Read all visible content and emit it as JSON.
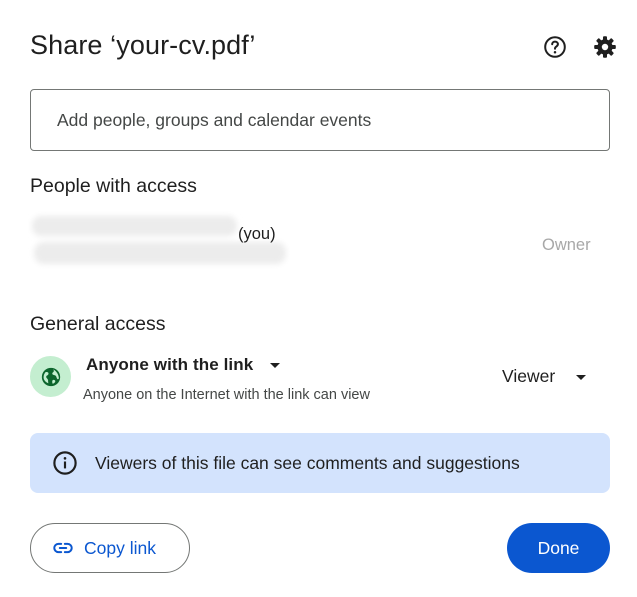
{
  "dialog": {
    "title": "Share ‘your-cv.pdf’",
    "icons": {
      "help": "help-circle-icon",
      "settings": "gear-icon"
    }
  },
  "add_people": {
    "value": "",
    "placeholder": "Add people, groups and calendar events"
  },
  "people_with_access": {
    "title": "People with access",
    "members": [
      {
        "name": "",
        "suffix": "(you)",
        "role": "Owner",
        "name_redacted": true
      }
    ]
  },
  "general_access": {
    "title": "General access",
    "icon": "globe-icon",
    "selected_option": "Anyone with the link",
    "description": "Anyone on the Internet with the link can view",
    "role": "Viewer"
  },
  "info_banner": {
    "icon": "info-icon",
    "text": "Viewers of this file can see comments and suggestions"
  },
  "footer": {
    "copy_link_label": "Copy link",
    "copy_link_icon": "link-icon",
    "done_label": "Done"
  },
  "colors": {
    "accent": "#0b57d0",
    "banner_background": "#d3e3fd",
    "globe_background": "#c4eed0",
    "owner_text": "#a8a8a8"
  }
}
